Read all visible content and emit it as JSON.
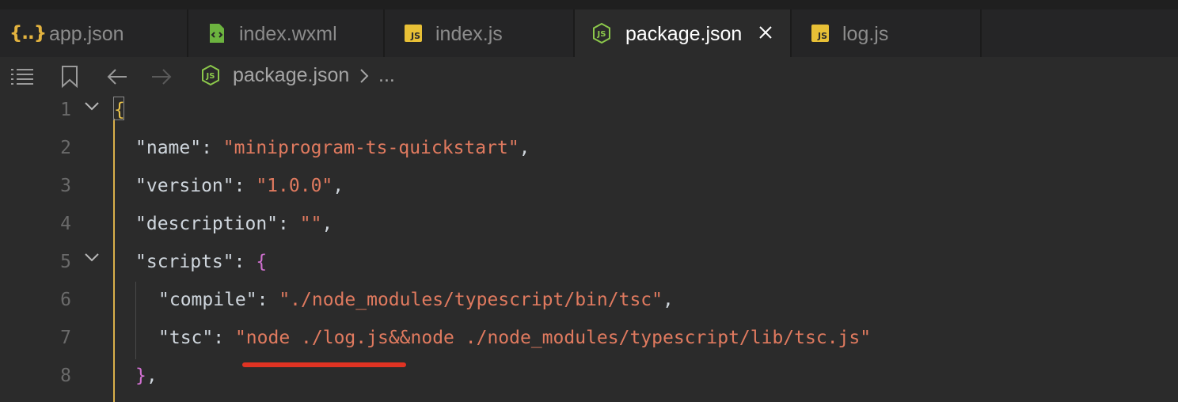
{
  "tabs": [
    {
      "label": "app.json",
      "icon": "json-braces-icon",
      "icon_text": "{..}"
    },
    {
      "label": "index.wxml",
      "icon": "wxml-file-icon"
    },
    {
      "label": "index.js",
      "icon": "js-file-icon",
      "icon_text": "JS"
    },
    {
      "label": "package.json",
      "icon": "nodejs-icon",
      "active": true,
      "closable": true
    },
    {
      "label": "log.js",
      "icon": "js-file-icon",
      "icon_text": "JS"
    }
  ],
  "breadcrumb": {
    "file": "package.json",
    "more": "..."
  },
  "lines": [
    {
      "n": "1"
    },
    {
      "n": "2"
    },
    {
      "n": "3"
    },
    {
      "n": "4"
    },
    {
      "n": "5"
    },
    {
      "n": "6"
    },
    {
      "n": "7"
    },
    {
      "n": "8"
    }
  ],
  "code": {
    "open_brace": "{",
    "name_key": "\"name\"",
    "name_val": "\"miniprogram-ts-quickstart\"",
    "version_key": "\"version\"",
    "version_val": "\"1.0.0\"",
    "desc_key": "\"description\"",
    "desc_val": "\"\"",
    "scripts_key": "\"scripts\"",
    "scripts_open": "{",
    "compile_key": "\"compile\"",
    "compile_val": "\"./node_modules/typescript/bin/tsc\"",
    "tsc_key": "\"tsc\"",
    "tsc_val": "\"node ./log.js&&node ./node_modules/typescript/lib/tsc.js\"",
    "scripts_close": "}",
    "colon": ": ",
    "comma": ","
  },
  "colors": {
    "string": "#e07a5f",
    "key": "#cfd6dd",
    "brace_outer": "#e7c14a",
    "brace_inner": "#d070d0",
    "annotation_underline": "#e03323",
    "js_badge": "#e8c036",
    "node_icon": "#8cc84b"
  }
}
